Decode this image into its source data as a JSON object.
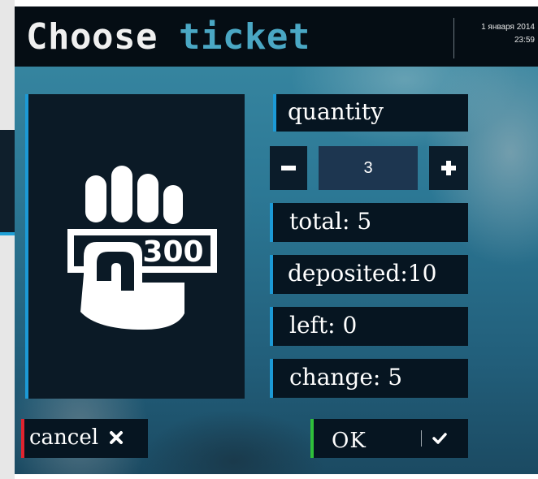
{
  "header": {
    "title_word1": "Choose",
    "title_word2": "ticket",
    "date": "1 января 2014",
    "time": "23:59"
  },
  "ticket": {
    "icon": "hand-300-ticket-icon",
    "icon_value": "300"
  },
  "quantity": {
    "label": "quantity",
    "value": "3",
    "minus_symbol": "−",
    "plus_symbol": "+"
  },
  "summary": {
    "total": "total: 5",
    "deposited": "deposited:10",
    "left": "left: 0",
    "change": "change: 5"
  },
  "buttons": {
    "cancel": "cancel",
    "ok": "OK"
  },
  "colors": {
    "accent_blue": "#1c9ad6",
    "title_accent": "#4aa7c4",
    "cancel_red": "#e0242f",
    "ok_green": "#2fbf3a",
    "panel_dark": "#061521"
  }
}
